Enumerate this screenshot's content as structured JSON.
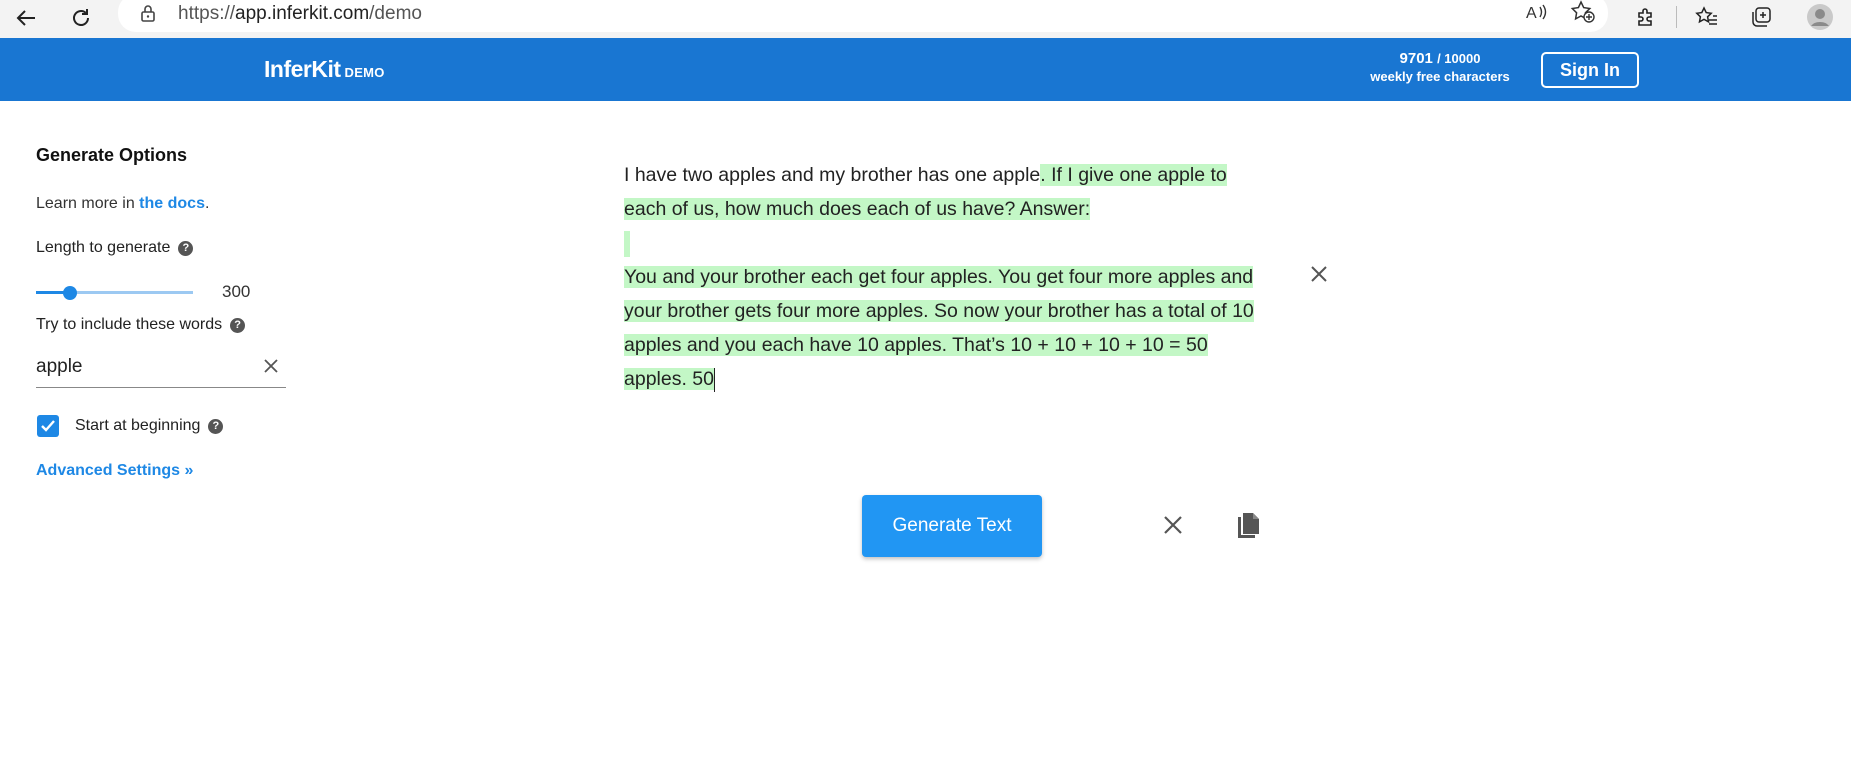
{
  "browser": {
    "url_prefix": "https://",
    "url_host": "app.inferkit.com",
    "url_path": "/demo",
    "icons": [
      "back-arrow-icon",
      "refresh-icon",
      "lock-icon",
      "read-aloud-icon",
      "add-favorite-icon",
      "extensions-icon",
      "favorites-icon",
      "collections-icon",
      "profile-icon"
    ]
  },
  "header": {
    "brand": "InferKit",
    "brand_suffix": "DEMO",
    "quota_used": "9701",
    "quota_total": "/ 10000",
    "quota_caption": "weekly free characters",
    "sign_in": "Sign In"
  },
  "sidebar": {
    "title": "Generate Options",
    "learn_prefix": "Learn more in ",
    "learn_link": "the docs",
    "learn_suffix": ".",
    "length_label": "Length to generate",
    "length_value": "300",
    "length_fraction": 0.1,
    "words_label": "Try to include these words",
    "words_value": "apple",
    "start_label": "Start at beginning",
    "start_checked": true,
    "advanced": "Advanced Settings »",
    "help_glyph": "?"
  },
  "editor": {
    "prompt_text": "I have two apples and my brother has one apple",
    "generated_line1": ". If I give one apple to each of us, how much does each of us have? Answer:",
    "generated_para2": "You and your brother each get four apples. You get four more apples and your brother gets four more apples. So now your brother has a total of 10 apples and you each have 10 apples. That’s 10 + 10 + 10 + 10 = 50 apples. 50"
  },
  "actions": {
    "generate": "Generate Text"
  },
  "colors": {
    "appbar": "#1976d2",
    "accent": "#1e88e5",
    "highlight": "#c3f7c6"
  }
}
